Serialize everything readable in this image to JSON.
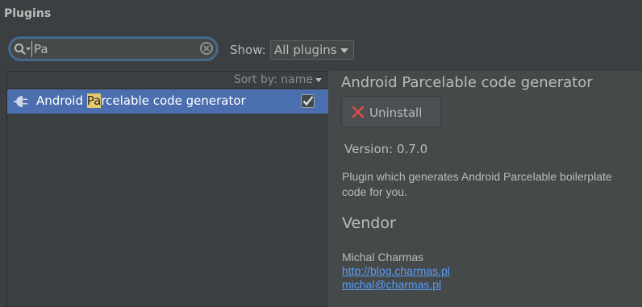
{
  "header": {
    "title": "Plugins"
  },
  "search": {
    "value": "Pa",
    "icon": "search-icon",
    "clear_icon": "clear-icon"
  },
  "filter": {
    "show_label": "Show:",
    "selected": "All plugins"
  },
  "list": {
    "sort_label": "Sort by: name",
    "items": [
      {
        "name_before": "Android ",
        "name_match": "Pa",
        "name_after": "rcelable code generator",
        "enabled": true,
        "icon": "plugin-icon"
      }
    ]
  },
  "details": {
    "title": "Android Parcelable code generator",
    "uninstall_label": "Uninstall",
    "version": "Version: 0.7.0",
    "description": "Plugin which generates Android Parcelable boilerplate code for you.",
    "vendor_heading": "Vendor",
    "vendor_name": "Michal Charmas",
    "vendor_url": "http://blog.charmas.pl",
    "vendor_email": "michal@charmas.pl"
  },
  "colors": {
    "background": "#3c3f41",
    "selection": "#4b6eaf",
    "link": "#589df6",
    "highlight": "#e5c96a",
    "uninstall_x": "#e04a4a"
  }
}
